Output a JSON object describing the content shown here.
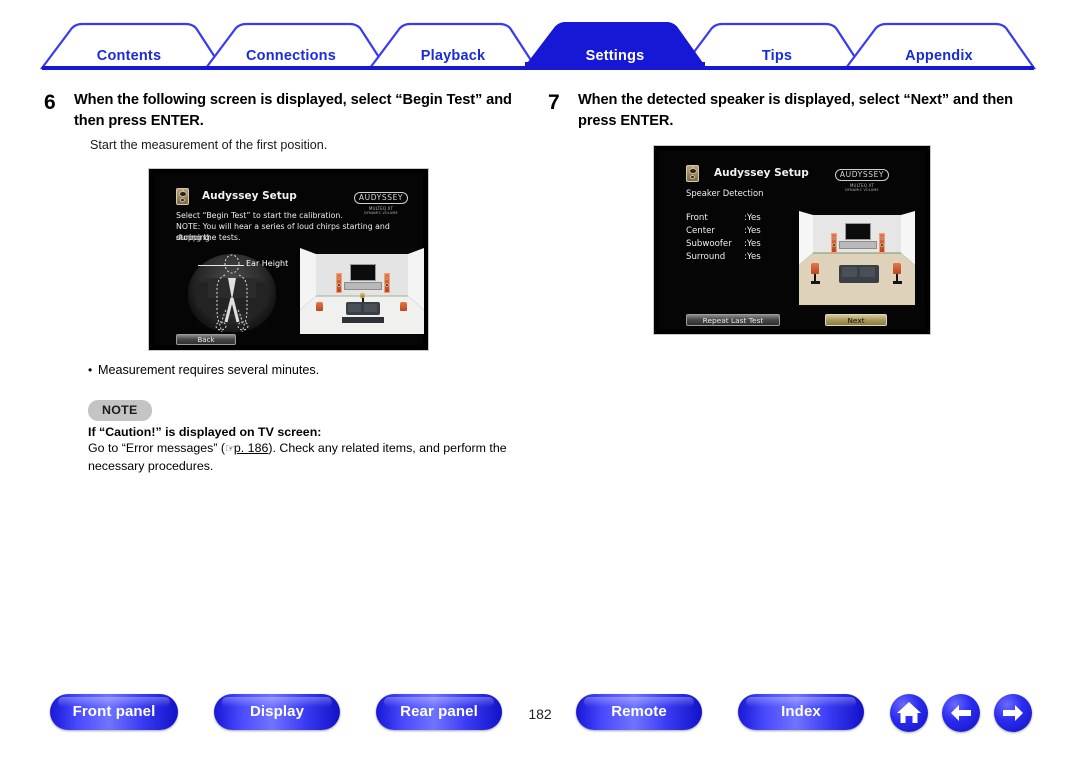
{
  "tabs": [
    {
      "label": "Contents",
      "active": false
    },
    {
      "label": "Connections",
      "active": false
    },
    {
      "label": "Playback",
      "active": false
    },
    {
      "label": "Settings",
      "active": true
    },
    {
      "label": "Tips",
      "active": false
    },
    {
      "label": "Appendix",
      "active": false
    }
  ],
  "steps": [
    {
      "number": "6",
      "title": "When the following screen is displayed, select “Begin Test” and then press ENTER.",
      "subtitle": "Start the measurement of the first position."
    },
    {
      "number": "7",
      "title": "When the detected speaker is displayed, select “Next” and then press ENTER.",
      "subtitle": ""
    }
  ],
  "osd_begin_test": {
    "title": "Audyssey Setup",
    "line1": "Select “Begin Test” to start the calibration.",
    "line2": "NOTE: You will hear a series of loud chirps starting and stopping",
    "line3": "during the tests.",
    "ear_height_label": "Ear Height",
    "back_button": "Back",
    "logo": {
      "brand": "AUDYSSEY",
      "sub1": "MULTEQ XT",
      "sub2": "DYNAMIC VOLUME"
    }
  },
  "osd_speaker_detection": {
    "title": "Audyssey Setup",
    "subtitle": "Speaker Detection",
    "detections": [
      {
        "name": "Front",
        "value": ":Yes"
      },
      {
        "name": "Center",
        "value": ":Yes"
      },
      {
        "name": "Subwoofer",
        "value": ":Yes"
      },
      {
        "name": "Surround",
        "value": ":Yes"
      }
    ],
    "repeat_button": "Repeat Last Test",
    "next_button": "Next",
    "logo": {
      "brand": "AUDYSSEY",
      "sub1": "MULTEQ XT",
      "sub2": "DYNAMIC VOLUME"
    }
  },
  "bullet": "Measurement requires several minutes.",
  "note": {
    "badge": "NOTE",
    "title": "If “Caution!” is displayed on TV screen:",
    "body_before": "Go to “Error messages” (",
    "hand_icon": "☞",
    "page_link": "p. 186",
    "body_after": "). Check any related items, and perform the necessary procedures."
  },
  "footer": {
    "buttons": [
      "Front panel",
      "Display",
      "Rear panel"
    ],
    "page_number": "182",
    "buttons_right": [
      "Remote",
      "Index"
    ],
    "icons": [
      "home-icon",
      "arrow-left-icon",
      "arrow-right-icon"
    ]
  },
  "colors": {
    "accent_blue": "#1a2bd8",
    "active_tab": "#1717d6",
    "note_badge": "#c4c4c4"
  }
}
